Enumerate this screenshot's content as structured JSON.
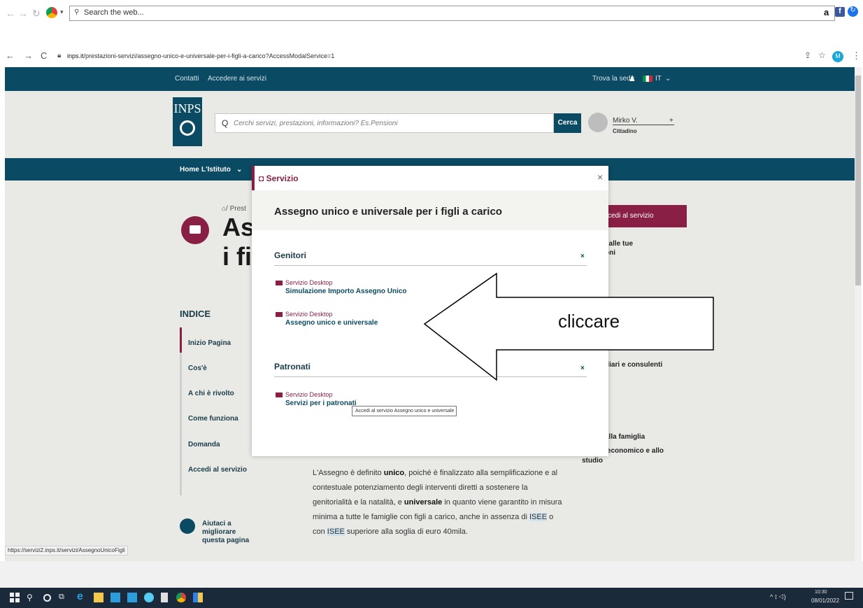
{
  "outer_browser": {
    "search_placeholder": "Search the web...",
    "right_icons": [
      "a",
      "f",
      "↻",
      "⋮"
    ]
  },
  "chrome": {
    "url_domain": "inps.it",
    "url_path": "/prestazioni-servizi/assegno-unico-e-universale-per-i-figli-a-carico?AccessModalService=1",
    "profile_initial": "M"
  },
  "site": {
    "top_links": [
      "Contatti",
      "Accedere ai servizi"
    ],
    "trova_sede": "Trova la sede",
    "lang": "IT",
    "logo_text": "INPS",
    "search_placeholder": "Cerchi servizi, prestazioni, informazioni? Es.Pensioni",
    "search_button": "Cerca",
    "user_name": "Mirko V.",
    "user_role": "Cittadino",
    "nav": [
      "Home",
      "L'Istituto"
    ],
    "breadcrumb": "/ Prest",
    "title_line1": "Ass",
    "title_line2": "i fig",
    "access_button": "ccedi al servizio",
    "right_texts": [
      "i alle tue",
      "oni",
      "diari e consulenti",
      "i",
      "alla famiglia",
      "o economico e allo",
      "studio"
    ],
    "index_title": "INDICE",
    "index_items": [
      "Inizio Pagina",
      "Cos'è",
      "A chi è rivolto",
      "Come funziona",
      "Domanda",
      "Accedi al servizio"
    ],
    "body": {
      "p1": "L'Assegno è definito ",
      "b1": "unico",
      "p2": ", poiché è finalizzato alla semplificazione e al contestuale potenziamento degli interventi diretti a sostenere la genitorialità e la natalità, e ",
      "b2": "universale",
      "p3": " in quanto viene garantito in misura minima a tutte le famiglie con figli a carico, anche in assenza di ",
      "isee1": "ISEE",
      "p4": " o con ",
      "isee2": "ISEE",
      "p5": " superiore alla soglia di euro 40mila."
    },
    "help_text": "Aiutaci a migliorare questa pagina",
    "status_url": "https://servizi2.inps.it/servizi/AssegnoUnicoFigli"
  },
  "modal": {
    "header": "Servizio",
    "close": "×",
    "title": "Assegno unico e universale per i figli a carico",
    "sections": [
      {
        "name": "Genitori",
        "toggle": "×",
        "items": [
          {
            "type": "Servizio Desktop",
            "label": "Simulazione Importo Assegno Unico"
          },
          {
            "type": "Servizio Desktop",
            "label": "Assegno unico e universale"
          }
        ]
      },
      {
        "name": "Patronati",
        "toggle": "×",
        "items": [
          {
            "type": "Servizio Desktop",
            "label": "Servizi per i patronati"
          }
        ]
      }
    ],
    "tooltip": "Accedi al servizio Assegno unico e universale"
  },
  "annotation": {
    "label": "cliccare"
  },
  "taskbar": {
    "date": "08/01/2022",
    "time": "10:30"
  }
}
